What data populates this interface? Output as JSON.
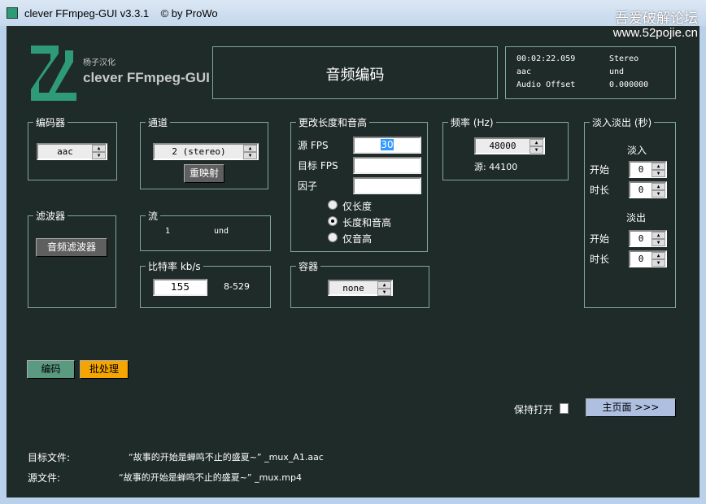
{
  "window": {
    "title": "clever FFmpeg-GUI v3.3.1    © by ProWo",
    "watermark_line1": "吾爱破解论坛",
    "watermark_line2": "www.52pojie.cn"
  },
  "logo": {
    "subtitle": "杨子汉化",
    "name": "clever FFmpeg-GUI"
  },
  "header": {
    "title": "音频编码"
  },
  "info": {
    "duration": "00:02:22.059",
    "channels": "Stereo",
    "codec": "aac",
    "language": "und",
    "offset_label": "Audio Offset",
    "offset_value": "0.000000"
  },
  "encoder": {
    "label": "编码器",
    "value": "aac"
  },
  "channels": {
    "label": "通道",
    "value": "2 (stereo)",
    "remap_button": "重映射"
  },
  "pitch": {
    "label": "更改长度和音高",
    "src_fps_label": "源 FPS",
    "src_fps_value": "30",
    "target_fps_label": "目标 FPS",
    "target_fps_value": "",
    "factor_label": "因子",
    "factor_value": "",
    "radio_options": [
      "仅长度",
      "长度和音高",
      "仅音高"
    ],
    "selected": 1
  },
  "frequency": {
    "label": "频率 (Hz)",
    "value": "48000",
    "source": "源: 44100"
  },
  "fade": {
    "label": "淡入淡出 (秒)",
    "fade_in": "淡入",
    "fade_out": "淡出",
    "start": "开始",
    "duration": "时长",
    "in_start": "0",
    "in_duration": "0",
    "out_start": "0",
    "out_duration": "0"
  },
  "filter": {
    "label": "滤波器",
    "button": "音频滤波器"
  },
  "stream": {
    "label": "流",
    "index": "1",
    "language": "und"
  },
  "bitrate": {
    "label": "比特率 kb/s",
    "value": "155",
    "range": "8-529"
  },
  "container": {
    "label": "容器",
    "value": "none"
  },
  "actions": {
    "encode": "编码",
    "batch": "批处理",
    "keep_open": "保持打开",
    "main_page": "主页面 >>>"
  },
  "files": {
    "target_label": "目标文件:",
    "target_value": "“故事的开始是蝉鸣不止的盛夏~” _mux_A1.aac",
    "source_label": "源文件:",
    "source_value": "“故事的开始是蝉鸣不止的盛夏~” _mux.mp4"
  },
  "colors": {
    "background": "#1f2b28",
    "accent": "#2e9a78",
    "batch": "#f5a500",
    "main_button": "#aebfe0"
  }
}
